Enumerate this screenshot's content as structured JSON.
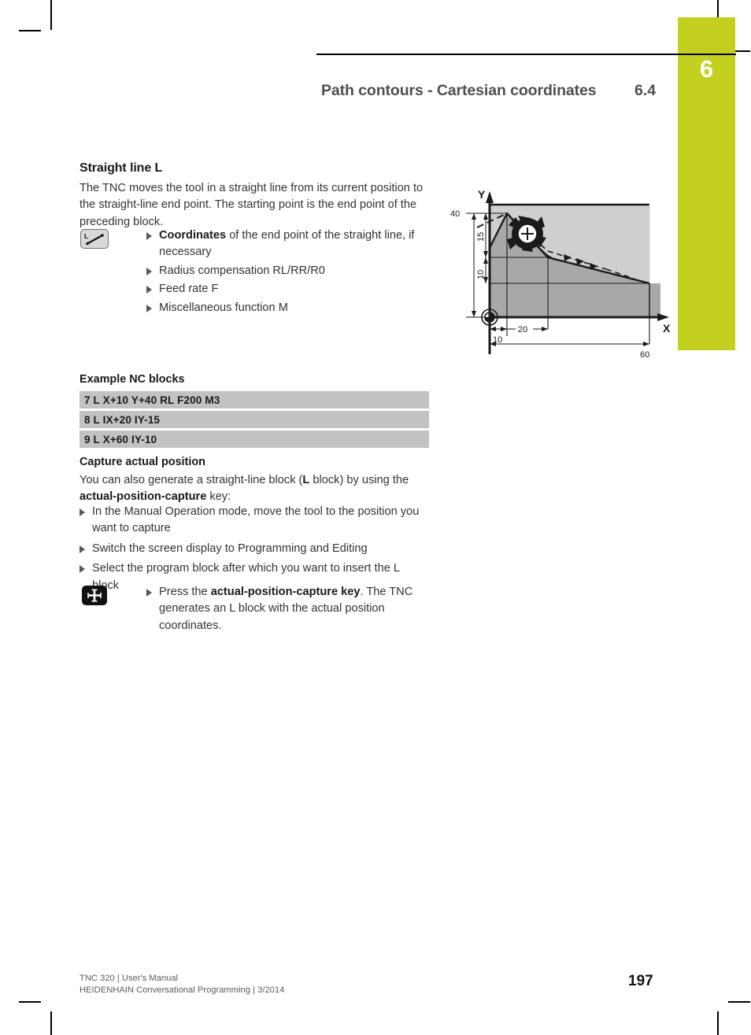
{
  "header": {
    "title": "Path contours - Cartesian coordinates",
    "section_number": "6.4",
    "chapter_number": "6",
    "chapter_tab_color": "#c3d020"
  },
  "section": {
    "title": "Straight line L",
    "intro": "The TNC moves the tool in a straight line from its current position to the straight-line end point. The starting point is the end point of the preceding block.",
    "key_icon": "straight-line-key-icon",
    "parameters": [
      {
        "bold": "Coordinates",
        "rest": " of the end point of the straight line, if necessary",
        "all_bold": false
      },
      {
        "bold": "Radius compensation RL/RR/R0",
        "rest": "",
        "all_bold": true
      },
      {
        "bold": "Feed rate F",
        "rest": "",
        "all_bold": true
      },
      {
        "bold": "Miscellaneous function M",
        "rest": "",
        "all_bold": true
      }
    ]
  },
  "nc_example": {
    "title": "Example NC blocks",
    "blocks": [
      "7 L X+10 Y+40 RL F200 M3",
      "8 L IX+20 IY-15",
      "9 L X+60 IY-10"
    ]
  },
  "capture": {
    "title": "Capture actual position",
    "intro_1": "You can also generate a straight-line block (",
    "intro_bold_1": "L",
    "intro_2": " block) by using the ",
    "intro_bold_2": "actual-position-capture",
    "intro_3": " key:",
    "steps": [
      "In the Manual Operation mode, move the tool to the position you want to capture",
      "Switch the screen display to Programming and Editing",
      "Select the program block after which you want to insert the L block"
    ],
    "key_icon": "actual-position-capture-key-icon",
    "final_step_1": "Press the ",
    "final_step_bold": "actual-position-capture key",
    "final_step_2": ". The TNC generates an L block with the actual position coordinates."
  },
  "figure": {
    "name": "straight-line-contour-diagram",
    "axis_x_label": "X",
    "axis_y_label": "Y",
    "labels": {
      "y_top": "40",
      "y_seg_upper": "15",
      "y_seg_lower": "10",
      "x_first": "10",
      "x_second": "20",
      "x_total": "60"
    },
    "colors": {
      "workpiece_light": "#cfcfcf",
      "workpiece_dark": "#a8a8a8",
      "outline": "#1a1a1a"
    }
  },
  "footer": {
    "line_1": "TNC 320 | User's Manual",
    "line_2": "HEIDENHAIN Conversational Programming | 3/2014",
    "page_number": "197"
  }
}
